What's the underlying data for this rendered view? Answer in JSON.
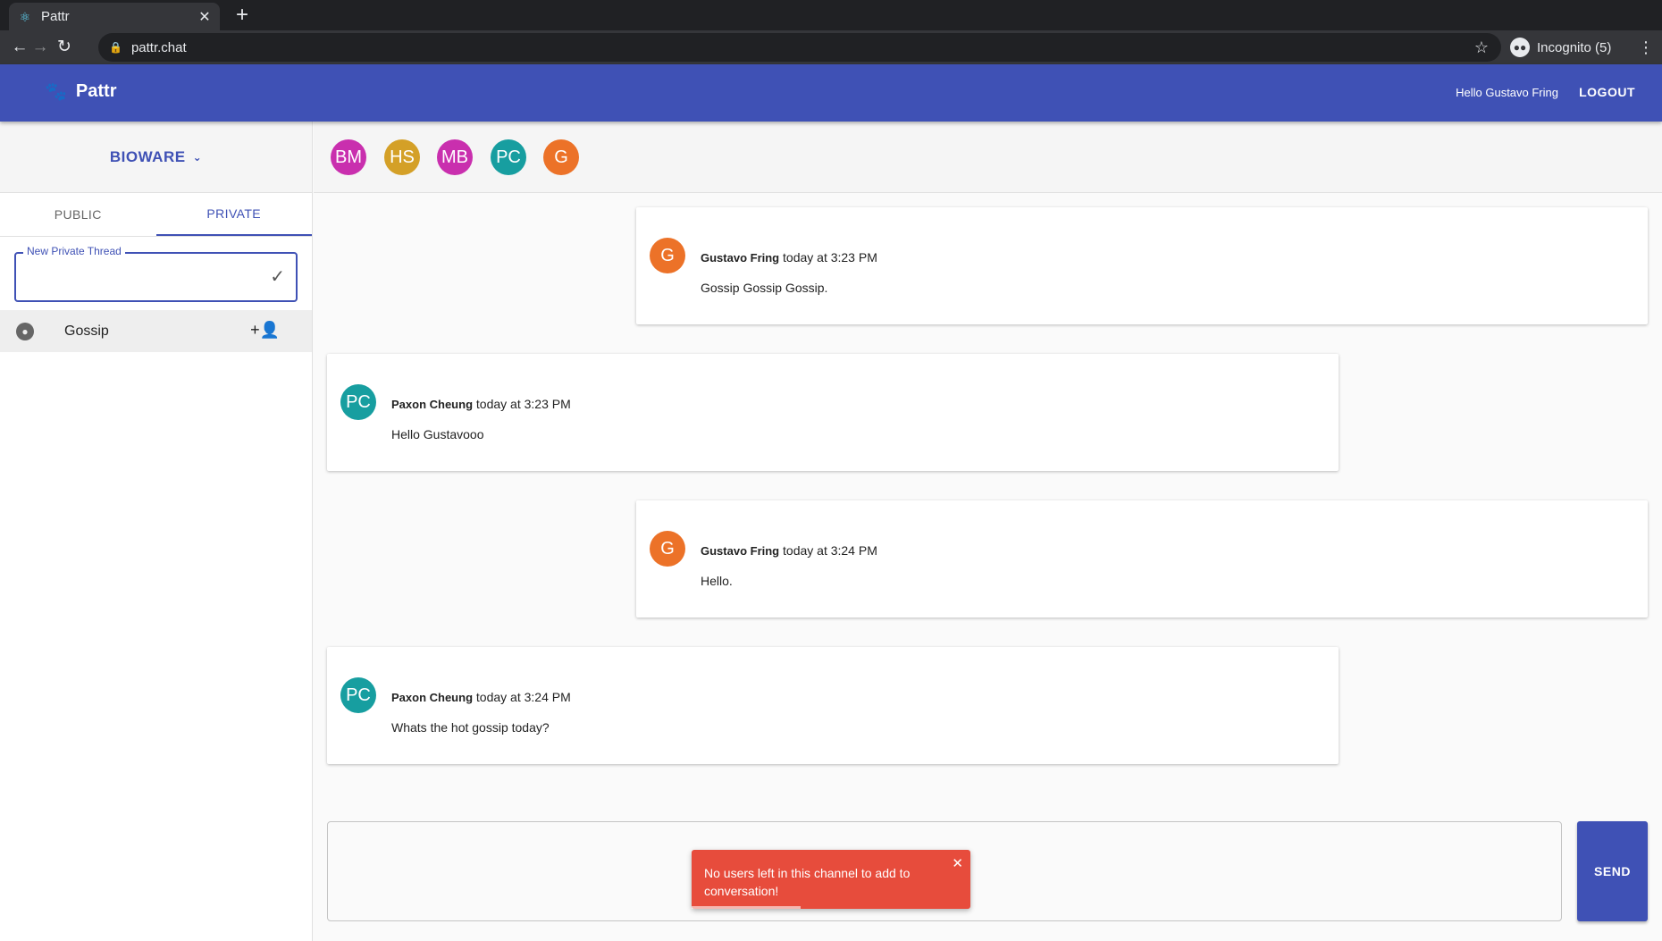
{
  "browser": {
    "tab_title": "Pattr",
    "url": "pattr.chat",
    "incognito_label": "Incognito (5)"
  },
  "app": {
    "name": "Pattr",
    "greeting": "Hello Gustavo Fring",
    "logout_label": "LOGOUT",
    "brand_color": "#3f51b5"
  },
  "sidebar": {
    "org_name": "BIOWARE",
    "tabs": [
      {
        "label": "PUBLIC",
        "active": false
      },
      {
        "label": "PRIVATE",
        "active": true
      }
    ],
    "new_thread_label": "New Private Thread",
    "new_thread_value": "",
    "threads": [
      {
        "name": "Gossip"
      }
    ]
  },
  "members": [
    {
      "initials": "BM",
      "color": "#c92fae"
    },
    {
      "initials": "HS",
      "color": "#d4a027"
    },
    {
      "initials": "MB",
      "color": "#c92fae"
    },
    {
      "initials": "PC",
      "color": "#179ea0"
    },
    {
      "initials": "G",
      "color": "#ec7228"
    }
  ],
  "messages": [
    {
      "initials": "G",
      "color": "#ec7228",
      "author": "Gustavo Fring",
      "time": "today at 3:23 PM",
      "text": "Gossip Gossip Gossip."
    },
    {
      "initials": "PC",
      "color": "#179ea0",
      "author": "Paxon Cheung",
      "time": "today at 3:23 PM",
      "text": "Hello Gustavooo"
    },
    {
      "initials": "G",
      "color": "#ec7228",
      "author": "Gustavo Fring",
      "time": "today at 3:24 PM",
      "text": "Hello."
    },
    {
      "initials": "PC",
      "color": "#179ea0",
      "author": "Paxon Cheung",
      "time": "today at 3:24 PM",
      "text": "Whats the hot gossip today?"
    }
  ],
  "composer": {
    "send_label": "SEND"
  },
  "toast": {
    "message": "No users left in this channel to add to conversation!",
    "color": "#e74c3c"
  }
}
